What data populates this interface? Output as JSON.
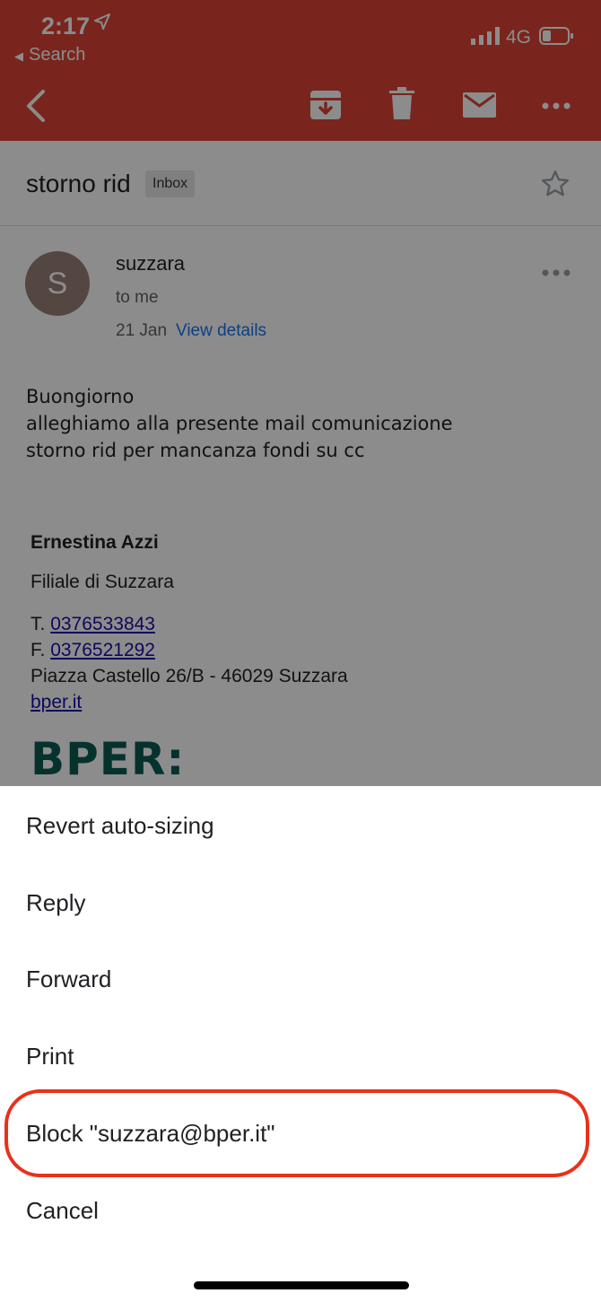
{
  "status_bar": {
    "time": "2:17",
    "back_label": "Search",
    "network": "4G"
  },
  "toolbar": {
    "icons": [
      "back-chevron-icon",
      "archive-icon",
      "trash-icon",
      "mail-icon",
      "more-horizontal-icon"
    ]
  },
  "email": {
    "subject": "storno rid",
    "label": "Inbox",
    "avatar_letter": "S",
    "sender": "suzzara",
    "recipient": "to me",
    "date": "21 Jan",
    "view_details": "View details",
    "body_lines": [
      "Buongiorno",
      "alleghiamo alla presente mail comunicazione",
      "storno rid per mancanza fondi su cc"
    ],
    "signature": {
      "name": "Ernestina Azzi",
      "branch": "Filiale di Suzzara",
      "phone_prefix": "T.",
      "phone": "0376533843",
      "fax_prefix": "F.",
      "fax": "0376521292",
      "address": "Piazza Castello 26/B - 46029 Suzzara",
      "website": "bper.it",
      "logo_text": "BPER:"
    }
  },
  "action_sheet": {
    "items": [
      "Revert auto-sizing",
      "Reply",
      "Forward",
      "Print",
      "Block \"suzzara@bper.it\"",
      "Cancel"
    ],
    "highlight_color": "#e8311c"
  },
  "colors": {
    "toolbar": "#dc4437",
    "link": "#1a73e8"
  }
}
